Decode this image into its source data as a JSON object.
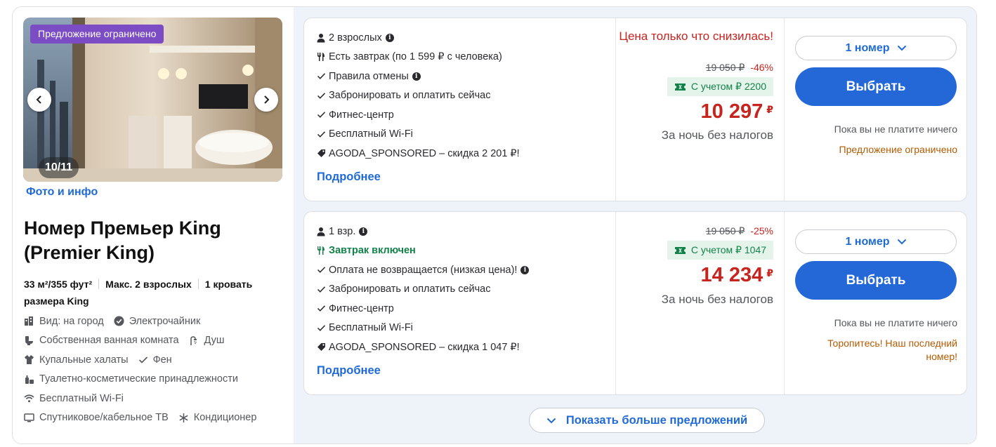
{
  "gallery": {
    "promo_badge": "Предложение ограничено",
    "counter": "10/11",
    "photo_link": "Фото и инфо"
  },
  "room": {
    "title": "Номер Премьер King (Premier King)",
    "size": "33 м²/355 фут²",
    "max_guests": "Макс. 2 взрослых",
    "bed": "1 кровать размера King",
    "amenities": {
      "city_view": "Вид: на город",
      "kettle": "Электрочайник",
      "bathroom": "Собственная ванная комната",
      "shower": "Душ",
      "bathrobes": "Купальные халаты",
      "hairdryer": "Фен",
      "toiletries": "Туалетно-косметические принадлежности",
      "wifi": "Бесплатный Wi-Fi",
      "tv": "Спутниковое/кабельное ТВ",
      "ac": "Кондиционер"
    }
  },
  "offers": [
    {
      "guests": "2 взрослых",
      "breakfast": "Есть завтрак (по 1 599 ₽ с человека)",
      "cancellation": "Правила отмены",
      "book_now": "Забронировать и оплатить сейчас",
      "fitness": "Фитнес-центр",
      "wifi": "Бесплатный Wi-Fi",
      "coupon_text": "AGODA_SPONSORED – скидка 2 201 ₽!",
      "more_link": "Подробнее",
      "price_drop": "Цена только что снизилась!",
      "old_price": "19 050 ₽",
      "discount": "-46%",
      "coupon_price": "С учетом ₽ 2200",
      "price": "10 297",
      "currency": "₽",
      "per_night": "За ночь без налогов",
      "room_select": "1 номер",
      "select_button": "Выбрать",
      "pay_note": "Пока вы не платите ничего",
      "urgency": "Предложение ограничено"
    },
    {
      "guests": "1 взр.",
      "breakfast": "Завтрак включен",
      "cancellation": "Оплата не возвращается (низкая цена)!",
      "book_now": "Забронировать и оплатить сейчас",
      "fitness": "Фитнес-центр",
      "wifi": "Бесплатный Wi-Fi",
      "coupon_text": "AGODA_SPONSORED – скидка 1 047 ₽!",
      "more_link": "Подробнее",
      "old_price": "19 050 ₽",
      "discount": "-25%",
      "coupon_price": "С учетом ₽ 1047",
      "price": "14 234",
      "currency": "₽",
      "per_night": "За ночь без налогов",
      "room_select": "1 номер",
      "select_button": "Выбрать",
      "pay_note": "Пока вы не платите ничего",
      "urgency": "Торопитесь! Наш последний номер!"
    }
  ],
  "show_more": "Показать больше предложений",
  "colors": {
    "link_blue": "#1f6ad6",
    "button_blue": "#2467d6",
    "price_red": "#c6241f",
    "green": "#12814a",
    "urgency_orange": "#b35a00",
    "promo_purple": "#7b4cc4"
  }
}
